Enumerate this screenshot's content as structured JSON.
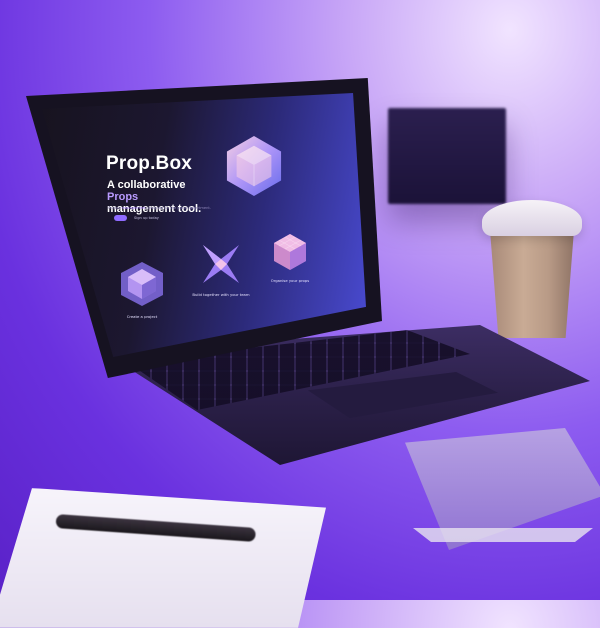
{
  "screen": {
    "brand": "Prop.Box",
    "headline_part1": "A collaborative ",
    "headline_accent": "Props",
    "headline_part2": "management tool.",
    "desc_part1": "Project ",
    "desc_accent": "management",
    "desc_part2": " designed for the props department.",
    "cta_link": "Sign up today",
    "features": [
      {
        "label": "Create a project",
        "icon": "gem-cube-icon"
      },
      {
        "label": "Build together with your team",
        "icon": "star-shape-icon"
      },
      {
        "label": "Organise your props",
        "icon": "grid-cube-icon"
      }
    ]
  },
  "colors": {
    "accent": "#b99bff",
    "background": "#7a45e6",
    "cta": "#8f6bff"
  }
}
